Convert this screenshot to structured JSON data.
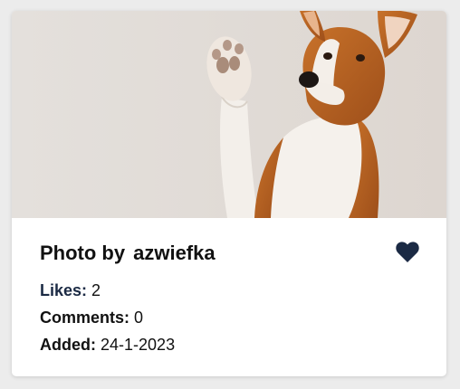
{
  "card": {
    "photo_subject": "basenji dog raising a paw",
    "title_prefix": "Photo by",
    "author": "azwiefka",
    "like_icon": "heart-icon",
    "accent_color": "#1b2a44",
    "stats": {
      "likes_label": "Likes:",
      "likes_value": "2",
      "comments_label": "Comments:",
      "comments_value": "0",
      "added_label": "Added:",
      "added_value": "24-1-2023"
    }
  }
}
